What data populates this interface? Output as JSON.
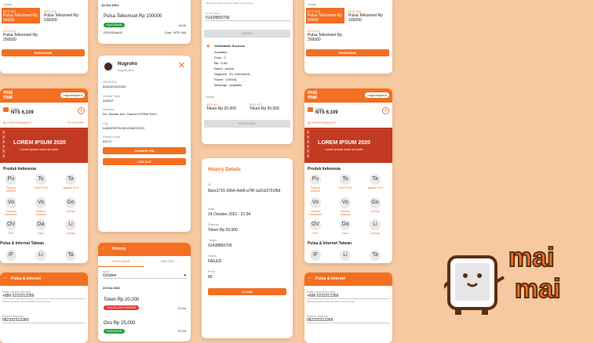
{
  "col1_top": {
    "variant_label": "Varian",
    "v1_code": "NTS 343",
    "v1_name": "Pulsa Telkomsel Rp 50000",
    "v2_code": "NTS 244",
    "v2_name": "Pulsa Telkomsel Rp 100000",
    "v3_code": "NTS 373",
    "v3_name": "Pulsa Telkomsel Rp 200000",
    "purchase": "PURCHASE"
  },
  "home": {
    "user": "nugroho@erd",
    "saldo_label": "Saldo",
    "saldo": "NTS 6,109",
    "performance": "PERFORMANCE",
    "history": "HISTORY",
    "banner_title": "LOREM IPSUM 2020",
    "banner_sub": "Lorem ipsum dolor sit amet",
    "section1": "Produk Indonesia",
    "section2": "Pulsa & Internet Taiwan"
  },
  "icons_id": [
    {
      "abbr": "Pu",
      "label": "Pulsa & Internet"
    },
    {
      "abbr": "To",
      "label": "Token PLN"
    },
    {
      "abbr": "Ta",
      "label": "Tagihan PLN"
    },
    {
      "abbr": "Vo",
      "label": "Voucher Indomaret"
    },
    {
      "abbr": "Vo",
      "label": "Voucher Alfamart"
    },
    {
      "abbr": "Go",
      "label": "GoPay"
    },
    {
      "abbr": "OV",
      "label": "OVO"
    },
    {
      "abbr": "Da",
      "label": "Dana"
    },
    {
      "abbr": "Li",
      "label": "LinkAja"
    }
  ],
  "icons_tw": [
    {
      "abbr": "IF"
    },
    {
      "abbr": "Li"
    },
    {
      "abbr": "Ta"
    }
  ],
  "pulsa_form": {
    "title": "Pulsa & Internet",
    "phone_label": "Enter phone number",
    "phone": "+886 0232312289",
    "note": "*Received will be sent via SMS to this number",
    "number_label": "Nomor Telepon",
    "number": "082332312289"
  },
  "col2_top": {
    "date": "13 Oct 2021",
    "product": "Pulsa Telkomsel Rp 100000",
    "status": "SUCCESS",
    "time": "13:00",
    "ref": "FDGZDHAJII",
    "cost": "Cost : NTS 240"
  },
  "profile": {
    "name": "Nugroho",
    "handle": "nugrohoErd",
    "session_label": "SESSION",
    "session": "6282323312289",
    "vt_label": "Vendor Type",
    "vt": "AGENT",
    "addr_label": "Address",
    "addr": "Ds. Gander Kec. Gander RT/RW 03/01",
    "city_label": "City",
    "city": "KABUPATEN BOJONEGORO",
    "postal_label": "Postal Code",
    "postal": "62171",
    "change_pin": "CHANGE PIN",
    "logout": "LOG OUT"
  },
  "history": {
    "title": "History",
    "tab1": "PURCHASE",
    "tab2": "DEPOSIT",
    "month_label": "Month",
    "month": "October",
    "date": "24 Oct 2021",
    "i1_name": "Token Rp 20,000",
    "i1_status": "FAILED-REFUNDED",
    "i1_time": "21:34",
    "i2_name": "Ovo Rp 25,000",
    "i2_status": "SUCCESS",
    "i2_time": "21:34"
  },
  "verify": {
    "note": "*Received will be sent via SMS to the number",
    "number_label": "Nomor Meter",
    "number": "01428800700",
    "verify_btn": "VERIFY",
    "success": "Verification Success",
    "lines": [
      "Available : -",
      "Price : 0",
      "Bill : 0.06",
      "Name : aneuh",
      "Segment : R1 1300VA/VA",
      "Power : 1300VA",
      "Message : Available"
    ],
    "variant_label": "Varian",
    "v1_code": "NTS 80",
    "v1_name": "Token Rp 20,000",
    "v2_code": "NTS 177",
    "v2_name": "Token Rp 50,000",
    "purchase": "PURCHASE"
  },
  "details": {
    "title": "History Details",
    "id_label": "ID",
    "id": "8ace1716-26b6-4eb6-a78f-1a2cb3701f6d",
    "date_label": "Date",
    "date": "24 October 2021 - 21:34",
    "product_label": "Product",
    "product": "Token Rp 20,000",
    "target_label": "Target",
    "target": "01428800700",
    "status_label": "Status",
    "status": "FAILED",
    "price_label": "Price",
    "price": "80",
    "close": "CLOSE"
  },
  "logo": {
    "text1": "mai",
    "text2": "mai"
  },
  "colors": {
    "accent": "#f36f21",
    "background": "#f7c9a0",
    "success": "#2e9e44",
    "failed": "#e53935"
  }
}
